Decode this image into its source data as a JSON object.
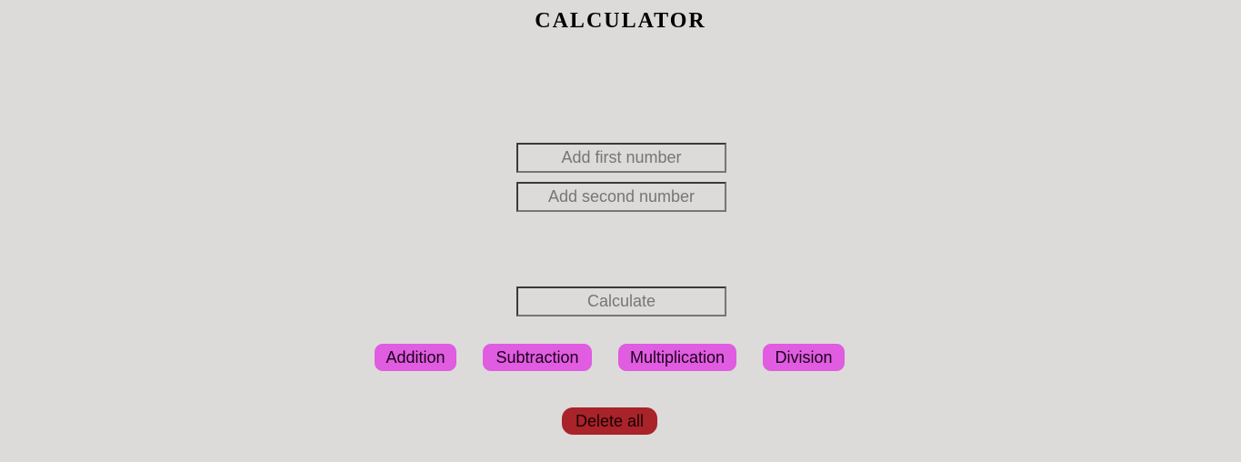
{
  "header": {
    "title": "CALCULATOR"
  },
  "inputs": {
    "first": {
      "placeholder": "Add first number",
      "value": ""
    },
    "second": {
      "placeholder": "Add second number",
      "value": ""
    },
    "result": {
      "placeholder": "Calculate",
      "value": ""
    }
  },
  "operations": {
    "addition": "Addition",
    "subtraction": "Subtraction",
    "multiplication": "Multiplication",
    "division": "Division"
  },
  "actions": {
    "delete_all": "Delete all"
  },
  "colors": {
    "background": "#dcdbd9",
    "operation_button": "#e05ce0",
    "delete_button": "#a8232a"
  }
}
